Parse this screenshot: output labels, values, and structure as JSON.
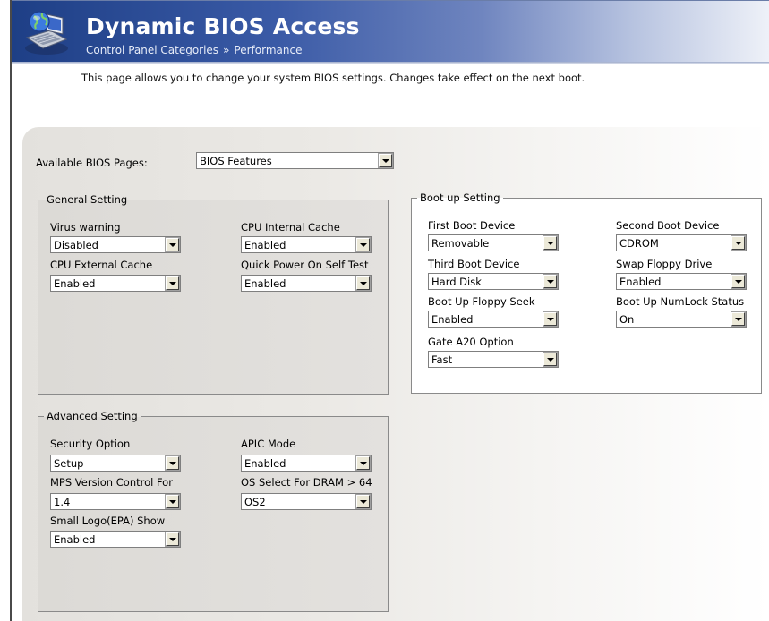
{
  "header": {
    "title": "Dynamic BIOS Access",
    "breadcrumb": [
      "Control Panel Categories",
      "Performance"
    ],
    "breadcrumb_separator": "»"
  },
  "description": "This page allows you to change your system BIOS settings.  Changes take effect on the next boot.",
  "available_pages": {
    "label": "Available BIOS Pages:",
    "value": "BIOS Features"
  },
  "general": {
    "title": "General Setting",
    "fields": [
      {
        "label": "Virus warning",
        "value": "Disabled"
      },
      {
        "label": "CPU Internal Cache",
        "value": "Enabled"
      },
      {
        "label": "CPU External Cache",
        "value": "Enabled"
      },
      {
        "label": "Quick Power On Self Test",
        "value": "Enabled"
      }
    ]
  },
  "boot": {
    "title": "Boot up Setting",
    "fields": [
      {
        "label": "First Boot Device",
        "value": "Removable"
      },
      {
        "label": "Second Boot Device",
        "value": "CDROM"
      },
      {
        "label": "Third Boot Device",
        "value": "Hard Disk"
      },
      {
        "label": "Swap Floppy Drive",
        "value": "Enabled"
      },
      {
        "label": "Boot Up Floppy Seek",
        "value": "Enabled"
      },
      {
        "label": "Boot Up NumLock Status",
        "value": "On"
      },
      {
        "label": "Gate A20 Option",
        "value": "Fast"
      }
    ]
  },
  "advanced": {
    "title": "Advanced Setting",
    "fields": [
      {
        "label": "Security Option",
        "value": "Setup"
      },
      {
        "label": "APIC Mode",
        "value": "Enabled"
      },
      {
        "label": "MPS Version Control For",
        "value": "1.4"
      },
      {
        "label": "OS Select For DRAM > 64",
        "value": "OS2"
      },
      {
        "label": "Small Logo(EPA) Show",
        "value": "Enabled"
      }
    ]
  },
  "colors": {
    "banner_dark": "#1e3f86",
    "banner_light": "#eef1f8",
    "panel_gray": "#e3e1dd"
  },
  "icons": {
    "logo": "computer-globe-icon",
    "dropdown": "chevron-down-icon"
  }
}
